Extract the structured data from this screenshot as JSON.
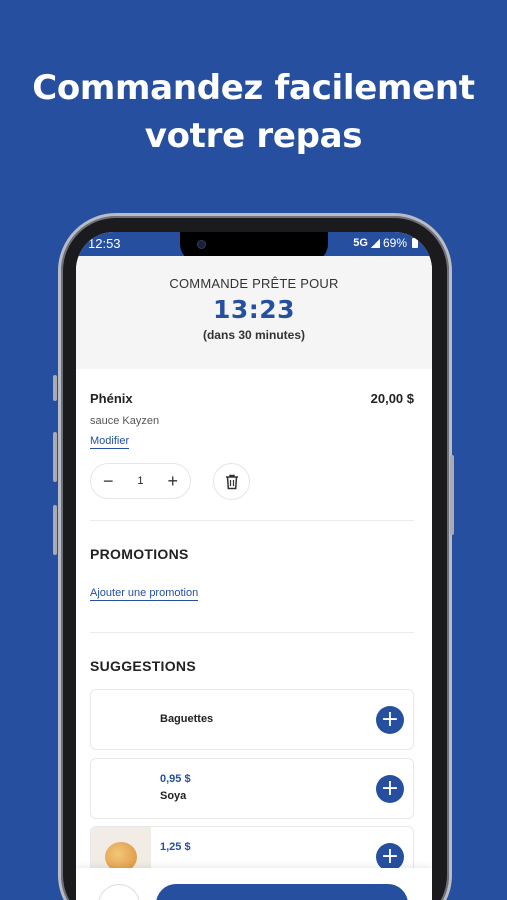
{
  "headline": {
    "line1": "Commandez facilement",
    "line2": "votre repas"
  },
  "statusbar": {
    "time": "12:53",
    "network": "5G",
    "battery": "69%"
  },
  "ready": {
    "label": "COMMANDE PRÊTE POUR",
    "time": "13:23",
    "sub": "(dans 30 minutes)"
  },
  "item": {
    "name": "Phénix",
    "price": "20,00 $",
    "sauce": "sauce Kayzen",
    "modify_label": "Modifier",
    "quantity": "1"
  },
  "promotions": {
    "title": "PROMOTIONS",
    "add_label": "Ajouter une promotion"
  },
  "suggestions": {
    "title": "SUGGESTIONS",
    "items": [
      {
        "name": "Baguettes",
        "price": ""
      },
      {
        "name": "Soya",
        "price": "0,95 $"
      },
      {
        "name": "",
        "price": "1,25 $"
      }
    ]
  },
  "icons": {
    "plus": "plus-icon",
    "minus": "minus-icon",
    "trash": "trash-icon",
    "add": "add-circle-icon"
  },
  "colors": {
    "brand": "#26509f",
    "background_panel": "#f5f5f5"
  }
}
